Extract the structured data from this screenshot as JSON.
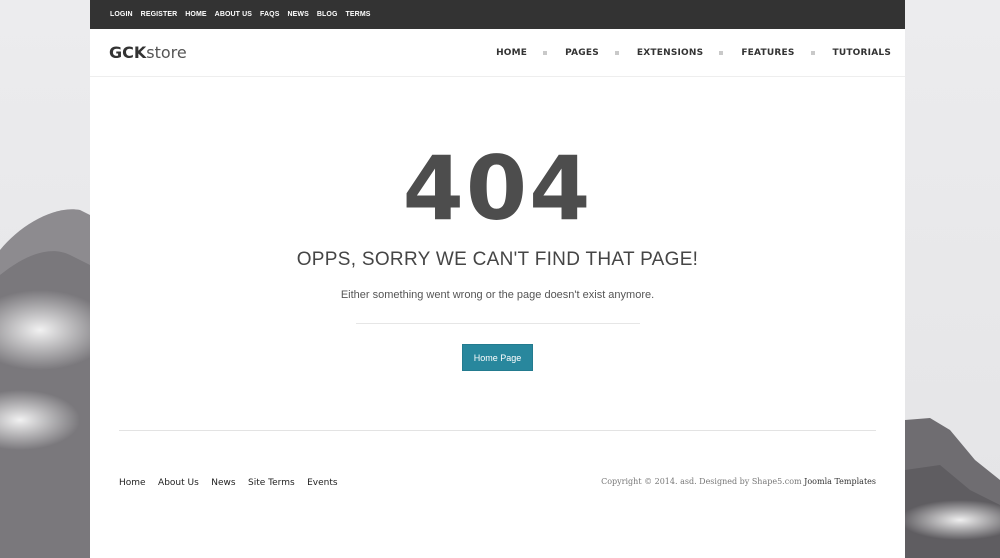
{
  "topbar": {
    "links": [
      "LOGIN",
      "REGISTER",
      "HOME",
      "ABOUT US",
      "FAQS",
      "NEWS",
      "BLOG",
      "TERMS"
    ]
  },
  "header": {
    "logo_bold": "GCK",
    "logo_light": "store",
    "nav": [
      "HOME",
      "PAGES",
      "EXTENSIONS",
      "FEATURES",
      "TUTORIALS"
    ]
  },
  "error": {
    "code": "404",
    "heading": "OPPS, SORRY WE CAN'T FIND THAT PAGE!",
    "message": "Either something went wrong or the page doesn't exist anymore.",
    "button_label": "Home Page"
  },
  "footer": {
    "links": [
      "Home",
      "About Us",
      "News",
      "Site Terms",
      "Events"
    ],
    "copyright_text": "Copyright © 2014. asd. Designed by Shape5.com",
    "copyright_link": "Joomla Templates"
  },
  "colors": {
    "topbar_bg": "#333333",
    "button_bg": "#28879d",
    "background": "#e9e9ea"
  }
}
